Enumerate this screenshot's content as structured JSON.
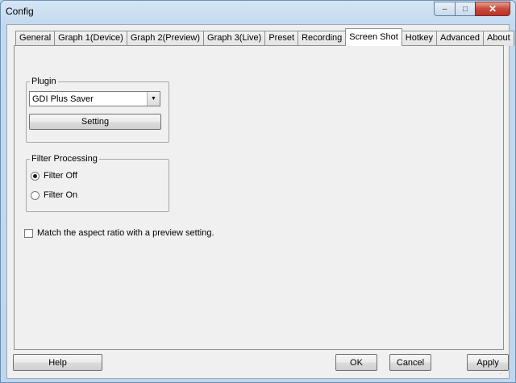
{
  "window": {
    "title": "Config",
    "minimize_glyph": "–",
    "maximize_glyph": "□",
    "close_glyph": "✕"
  },
  "tabs": [
    {
      "label": "General"
    },
    {
      "label": "Graph 1(Device)"
    },
    {
      "label": "Graph 2(Preview)"
    },
    {
      "label": "Graph 3(Live)"
    },
    {
      "label": "Preset"
    },
    {
      "label": "Recording"
    },
    {
      "label": "Screen Shot",
      "active": true
    },
    {
      "label": "Hotkey"
    },
    {
      "label": "Advanced"
    },
    {
      "label": "About"
    }
  ],
  "plugin": {
    "legend": "Plugin",
    "selected": "GDI Plus Saver",
    "setting_label": "Setting"
  },
  "filter": {
    "legend": "Filter Processing",
    "options": [
      {
        "label": "Filter Off",
        "checked": true
      },
      {
        "label": "Filter On",
        "checked": false
      }
    ]
  },
  "aspect": {
    "label": "Match the aspect ratio with a preview setting.",
    "checked": false
  },
  "buttons": {
    "help": "Help",
    "ok": "OK",
    "cancel": "Cancel",
    "apply": "Apply"
  }
}
